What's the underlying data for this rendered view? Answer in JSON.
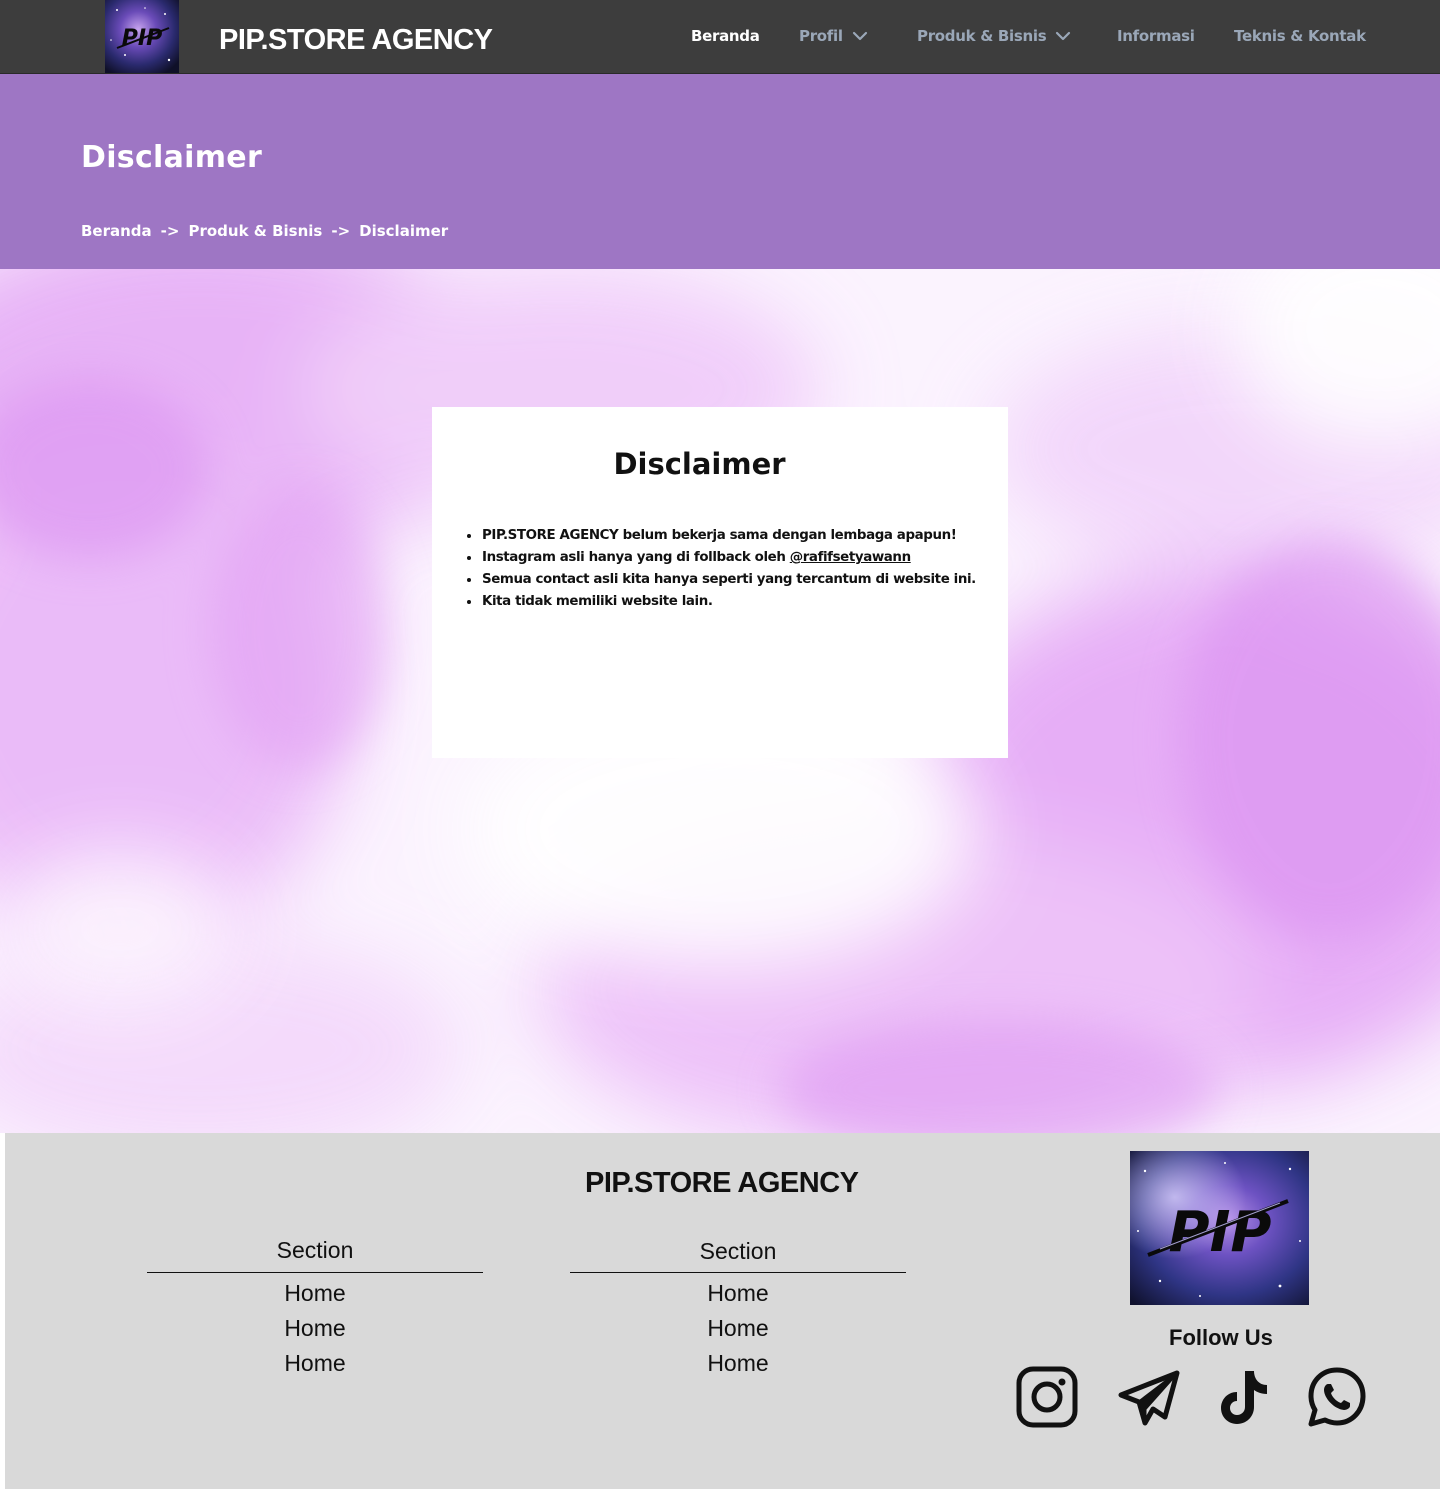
{
  "nav": {
    "brand": "PIP.STORE AGENCY",
    "items": [
      {
        "label": "Beranda",
        "active": true,
        "dropdown": false
      },
      {
        "label": "Profil",
        "active": false,
        "dropdown": true
      },
      {
        "label": "Produk & Bisnis",
        "active": false,
        "dropdown": true
      },
      {
        "label": "Informasi",
        "active": false,
        "dropdown": false
      },
      {
        "label": "Teknis & Kontak",
        "active": false,
        "dropdown": false
      }
    ]
  },
  "header": {
    "title": "Disclaimer",
    "breadcrumb": [
      "Beranda",
      "->",
      "Produk & Bisnis",
      "->",
      "Disclaimer"
    ]
  },
  "card": {
    "title": "Disclaimer",
    "items": [
      {
        "text": "PIP.STORE AGENCY belum bekerja sama dengan lembaga apapun!"
      },
      {
        "text": "Instagram asli hanya yang di follback oleh ",
        "link": "@rafifsetyawann"
      },
      {
        "text": "Semua contact asli kita hanya seperti yang tercantum di website ini."
      },
      {
        "text": "Kita tidak memiliki website lain."
      }
    ]
  },
  "footer": {
    "brand": "PIP.STORE AGENCY",
    "columns": [
      {
        "heading": "Section",
        "links": [
          "Home",
          "Home",
          "Home"
        ]
      },
      {
        "heading": "Section",
        "links": [
          "Home",
          "Home",
          "Home"
        ]
      }
    ],
    "logo_text": "PIP",
    "follow_label": "Follow Us",
    "social_icons": [
      "instagram-icon",
      "telegram-icon",
      "tiktok-icon",
      "whatsapp-icon"
    ]
  },
  "colors": {
    "nav_bg": "#3d3d3d",
    "nav_link": "#9aa7b8",
    "band_bg": "#9e76c4",
    "footer_bg": "#d9d9d9",
    "watercolor": "#d98ef0"
  }
}
